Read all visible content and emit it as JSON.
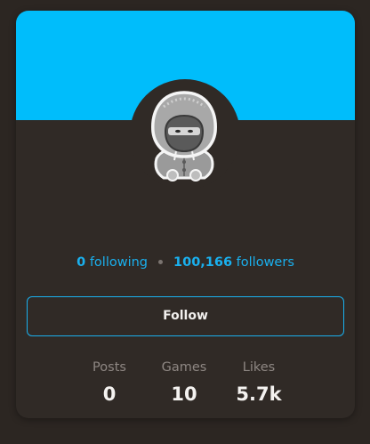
{
  "profile": {
    "banner_color": "#00bdfb",
    "avatar_icon": "hooded-ninja-avatar"
  },
  "social": {
    "following_count": "0",
    "following_label": "following",
    "followers_count": "100,166",
    "followers_label": "followers"
  },
  "actions": {
    "follow_label": "Follow"
  },
  "stats": [
    {
      "label": "Posts",
      "value": "0"
    },
    {
      "label": "Games",
      "value": "10"
    },
    {
      "label": "Likes",
      "value": "5.7k"
    }
  ],
  "colors": {
    "accent": "#1ab0ee",
    "background": "#2c2622",
    "card": "#302a26"
  }
}
